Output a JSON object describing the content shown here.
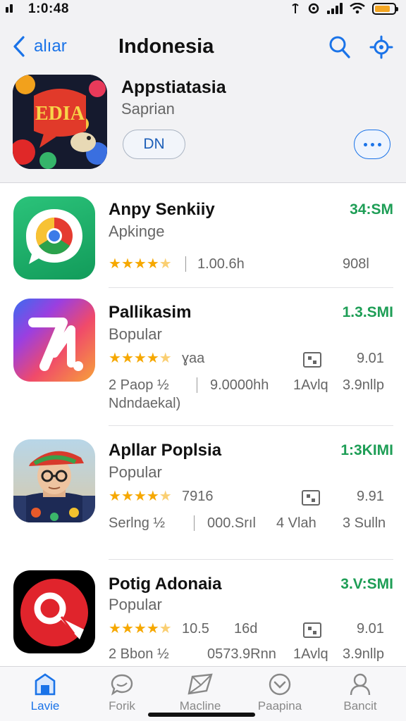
{
  "status_bar": {
    "time": "1:0:48"
  },
  "header": {
    "back_label": "alıar",
    "title": "Indonesia"
  },
  "featured": {
    "name": "Appstiatasia",
    "subtitle": "Saprian",
    "icon_text": "EDIA",
    "get_button_label": "DN",
    "more_button": "more-options"
  },
  "apps": [
    {
      "name": "Anpy Senkiiy",
      "category": "Apkinge",
      "size": "34:SM",
      "rating_stars": 4.5,
      "rating_text": "",
      "downloads": "1.00.6h",
      "extra": "908l",
      "line2": [],
      "line3": "",
      "icon": "chrome-chat-icon"
    },
    {
      "name": "Pallikasim",
      "category": "Bopular",
      "size": "1.3.SMI",
      "rating_stars": 4.5,
      "rating_text": "ɣaa",
      "extra": "9.01",
      "line2": [
        "2 Paop ½",
        "9.0000hh",
        "1Avlq",
        "3.9nllp"
      ],
      "line3": "Ndndaekal)",
      "icon": "gradient-seven-icon"
    },
    {
      "name": "Apllar Poplsia",
      "category": "Popular",
      "size": "1:3KIMI",
      "rating_stars": 4.5,
      "rating_text": "7916",
      "extra": "9.91",
      "line2": [
        "Serlng ½",
        "000.Srıl",
        "4 Vlah",
        "3 Sulln"
      ],
      "line3": "",
      "icon": "boy-avatar-icon"
    },
    {
      "name": "Potig Adonaia",
      "category": "Popular",
      "size": "3.V:SMI",
      "rating_stars": 4.5,
      "rating_text": "10.5",
      "rating_text2": "16d",
      "extra": "9.01",
      "line2": [
        "2 Bbon ½",
        "0573.9Rnn",
        "1Avlq",
        "3.9nllp"
      ],
      "line3": "",
      "icon": "red-magnifier-icon"
    }
  ],
  "tabs": [
    {
      "label": "Lavie",
      "icon": "today-icon",
      "active": true
    },
    {
      "label": "Forik",
      "icon": "chat-bubble-icon",
      "active": false
    },
    {
      "label": "Macline",
      "icon": "paper-plane-icon",
      "active": false
    },
    {
      "label": "Paapina",
      "icon": "compass-icon",
      "active": false
    },
    {
      "label": "Bancit",
      "icon": "person-icon",
      "active": false
    }
  ],
  "colors": {
    "accent": "#1a73e8",
    "size_green": "#1e9e56",
    "star": "#f6a800",
    "header_bg": "#f2f2f4"
  }
}
